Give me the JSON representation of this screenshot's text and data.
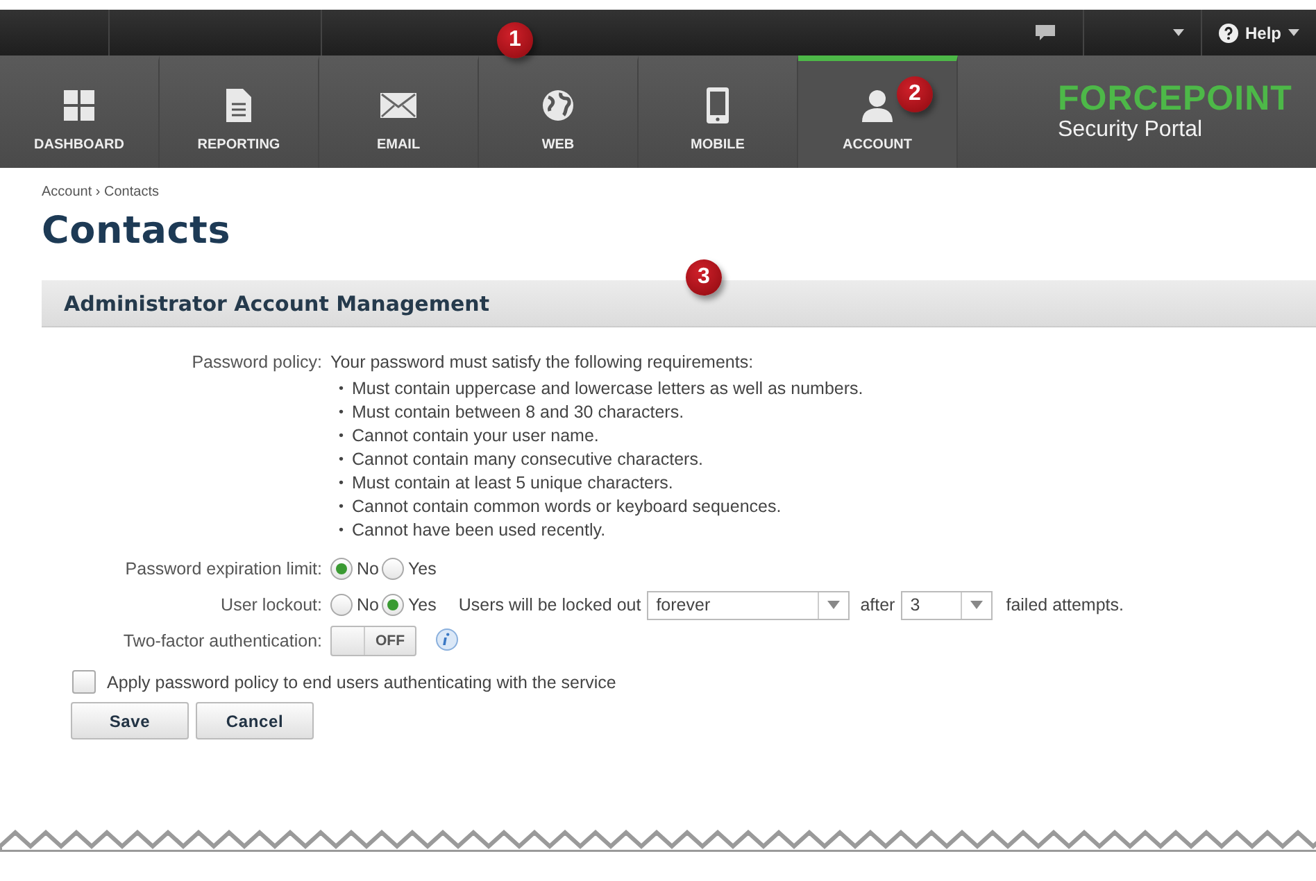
{
  "top_bar": {
    "help_label": "Help"
  },
  "nav": {
    "tabs": [
      {
        "label": "DASHBOARD",
        "kind": "grid",
        "selected": false
      },
      {
        "label": "REPORTING",
        "kind": "document",
        "selected": false
      },
      {
        "label": "EMAIL",
        "kind": "envelope",
        "selected": false
      },
      {
        "label": "WEB",
        "kind": "globe",
        "selected": false
      },
      {
        "label": "MOBILE",
        "kind": "phone",
        "selected": false
      },
      {
        "label": "ACCOUNT",
        "kind": "person",
        "selected": true
      }
    ],
    "logo": {
      "brand": "FORCEPOINT",
      "subtitle": "Security Portal"
    }
  },
  "callouts": [
    "1",
    "2",
    "3"
  ],
  "breadcrumb": "Account › Contacts",
  "page_title": "Contacts",
  "section_title": "Administrator Account Management",
  "form": {
    "password_policy": {
      "label": "Password policy:",
      "intro": "Your password must satisfy the following requirements:",
      "requirements": [
        {
          "bullet": "•",
          "text": "Must contain uppercase and lowercase letters as well as numbers."
        },
        {
          "bullet": "•",
          "text": "Must contain between 8 and 30 characters."
        },
        {
          "bullet": "•",
          "text": "Cannot contain your user name."
        },
        {
          "bullet": "•",
          "text": "Cannot contain many consecutive characters."
        },
        {
          "bullet": "•",
          "text": "Must contain at least 5 unique characters."
        },
        {
          "bullet": "•",
          "text": "Cannot contain common words or keyboard sequences."
        },
        {
          "bullet": "•",
          "text": "Cannot have been used recently."
        }
      ]
    },
    "expiration": {
      "label": "Password expiration limit:",
      "options": [
        {
          "label": "No",
          "selected": true
        },
        {
          "label": "Yes",
          "selected": false
        }
      ]
    },
    "lockout": {
      "label": "User lockout:",
      "options": [
        {
          "label": "No",
          "selected": false
        },
        {
          "label": "Yes",
          "selected": true
        }
      ],
      "lead": "Users will be locked out",
      "duration": "forever",
      "after": "after",
      "attempts": "3",
      "tail": "failed attempts."
    },
    "two_factor": {
      "label": "Two-factor authentication:",
      "toggle_text": "OFF",
      "on": false
    },
    "apply_policy": {
      "label": "Apply password policy to end users authenticating with the service",
      "checked": false
    },
    "buttons": [
      "Save",
      "Cancel"
    ]
  }
}
